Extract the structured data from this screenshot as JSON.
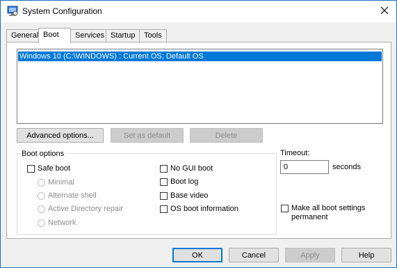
{
  "window": {
    "title": "System Configuration"
  },
  "tabs": [
    {
      "label": "General"
    },
    {
      "label": "Boot"
    },
    {
      "label": "Services"
    },
    {
      "label": "Startup"
    },
    {
      "label": "Tools"
    }
  ],
  "boot": {
    "os_entries": [
      "Windows 10 (C:\\WINDOWS) : Current OS; Default OS"
    ],
    "advanced_options": "Advanced options...",
    "set_default": "Set as default",
    "delete": "Delete",
    "boot_options_label": "Boot options",
    "safe_boot": "Safe boot",
    "minimal": "Minimal",
    "alternate_shell": "Alternate shell",
    "active_directory_repair": "Active Directory repair",
    "network": "Network",
    "no_gui_boot": "No GUI boot",
    "boot_log": "Boot log",
    "base_video": "Base video",
    "os_boot_information": "OS boot information",
    "timeout_label": "Timeout:",
    "timeout_value": "0",
    "seconds": "seconds",
    "make_permanent_line1": "Make all boot settings",
    "make_permanent_line2": "permanent"
  },
  "footer": {
    "ok": "OK",
    "cancel": "Cancel",
    "apply": "Apply",
    "help": "Help"
  },
  "colors": {
    "selection": "#0078d7",
    "border_accent": "#1a6fc0"
  },
  "icons": {
    "app": "system-configuration-icon",
    "close": "close-icon"
  }
}
